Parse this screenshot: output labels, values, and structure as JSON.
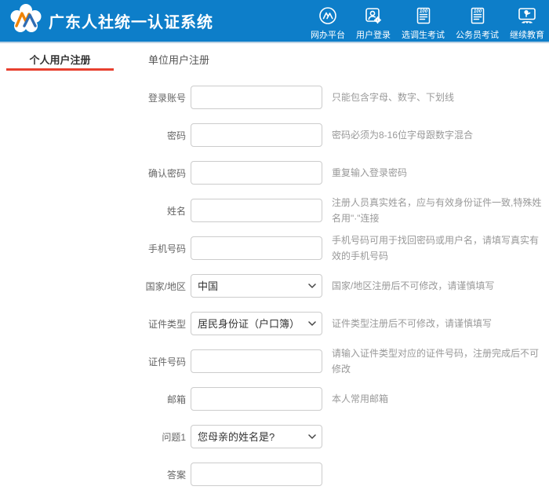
{
  "header": {
    "title": "广东人社统一认证系统",
    "nav": [
      {
        "label": "网办平台",
        "icon": "platform-icon"
      },
      {
        "label": "用户登录",
        "icon": "user-login-icon"
      },
      {
        "label": "选调生考试",
        "icon": "exam-icon"
      },
      {
        "label": "公务员考试",
        "icon": "exam-icon"
      },
      {
        "label": "继续教育",
        "icon": "education-icon"
      }
    ]
  },
  "tabs": [
    {
      "label": "个人用户注册",
      "active": true
    },
    {
      "label": "单位用户注册",
      "active": false
    }
  ],
  "form": {
    "fields": [
      {
        "name": "login-account",
        "label": "登录账号",
        "type": "text",
        "value": "",
        "hint": "只能包含字母、数字、下划线"
      },
      {
        "name": "password",
        "label": "密码",
        "type": "text",
        "value": "",
        "hint": "密码必须为8-16位字母跟数字混合"
      },
      {
        "name": "confirm-password",
        "label": "确认密码",
        "type": "text",
        "value": "",
        "hint": "重复输入登录密码"
      },
      {
        "name": "real-name",
        "label": "姓名",
        "type": "text",
        "value": "",
        "hint": "注册人员真实姓名，应与有效身份证件一致,特殊姓名用\"·\"连接"
      },
      {
        "name": "mobile-number",
        "label": "手机号码",
        "type": "text",
        "value": "",
        "hint": "手机号码可用于找回密码或用户名，请填写真实有效的手机号码"
      },
      {
        "name": "country-region",
        "label": "国家/地区",
        "type": "select",
        "value": "中国",
        "hint": "国家/地区注册后不可修改，请谨慎填写"
      },
      {
        "name": "id-type",
        "label": "证件类型",
        "type": "select",
        "value": "居民身份证（户口簿）",
        "hint": "证件类型注册后不可修改，请谨慎填写"
      },
      {
        "name": "id-number",
        "label": "证件号码",
        "type": "text",
        "value": "",
        "hint": "请输入证件类型对应的证件号码，注册完成后不可修改"
      },
      {
        "name": "email",
        "label": "邮箱",
        "type": "text",
        "value": "",
        "hint": "本人常用邮箱"
      },
      {
        "name": "security-question-1",
        "label": "问题1",
        "type": "select",
        "value": "您母亲的姓名是?",
        "hint": ""
      },
      {
        "name": "answer",
        "label": "答案",
        "type": "text",
        "value": "",
        "hint": ""
      }
    ]
  },
  "colors": {
    "header_blue": "#0d7ec9",
    "accent_red": "#e8402f",
    "logo_orange": "#f08300",
    "logo_blue": "#2f6db4"
  }
}
